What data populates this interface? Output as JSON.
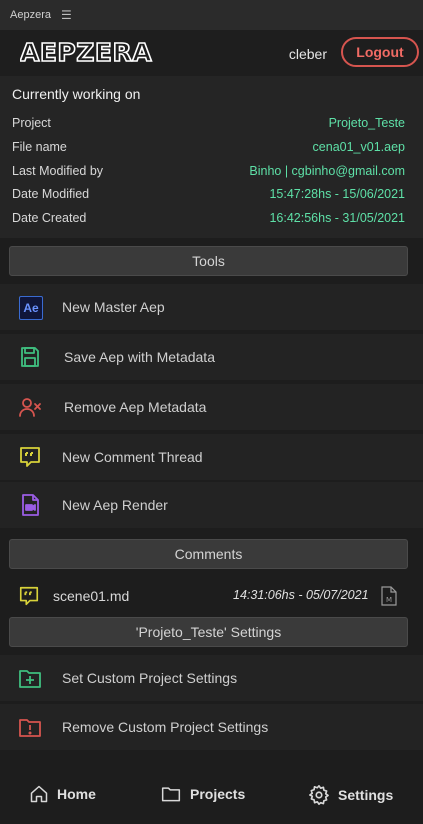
{
  "window": {
    "title": "Aepzera",
    "menu_glyph": "☰"
  },
  "header": {
    "logo_text": "AEPZERA",
    "username": "cleber",
    "logout_label": "Logout"
  },
  "working": {
    "heading": "Currently working on",
    "rows": [
      {
        "label": "Project",
        "value": "Projeto_Teste"
      },
      {
        "label": "File name",
        "value": "cena01_v01.aep"
      },
      {
        "label": "Last Modified by",
        "value": "Binho | cgbinho@gmail.com"
      },
      {
        "label": "Date Modified",
        "value": "15:47:28hs - 15/06/2021"
      },
      {
        "label": "Date Created",
        "value": "16:42:56hs - 31/05/2021"
      }
    ],
    "value_color": "#5ee0a7"
  },
  "tools": {
    "section_label": "Tools",
    "items": [
      {
        "label": "New Master Aep",
        "icon": "ae-icon",
        "icon_text": "Ae",
        "color": "#3a6bd1"
      },
      {
        "label": "Save Aep with Metadata",
        "icon": "save-icon",
        "color": "#3fbf7f"
      },
      {
        "label": "Remove Aep Metadata",
        "icon": "remove-user-icon",
        "color": "#d6554f"
      },
      {
        "label": "New Comment Thread",
        "icon": "comment-icon",
        "color": "#d8d23a"
      },
      {
        "label": "New Aep Render",
        "icon": "video-file-icon",
        "color": "#9b5de5"
      }
    ]
  },
  "comments": {
    "section_label": "Comments",
    "items": [
      {
        "name": "scene01.md",
        "timestamp": "14:31:06hs - 05/07/2021",
        "file_badge": "M"
      }
    ]
  },
  "project_settings": {
    "section_label": "'Projeto_Teste' Settings",
    "items": [
      {
        "label": "Set Custom Project Settings",
        "icon": "folder-plus-icon",
        "color": "#3fbf7f"
      },
      {
        "label": "Remove Custom Project Settings",
        "icon": "folder-alert-icon",
        "color": "#d6554f"
      }
    ]
  },
  "bottom_nav": {
    "home": "Home",
    "projects": "Projects",
    "settings": "Settings"
  }
}
